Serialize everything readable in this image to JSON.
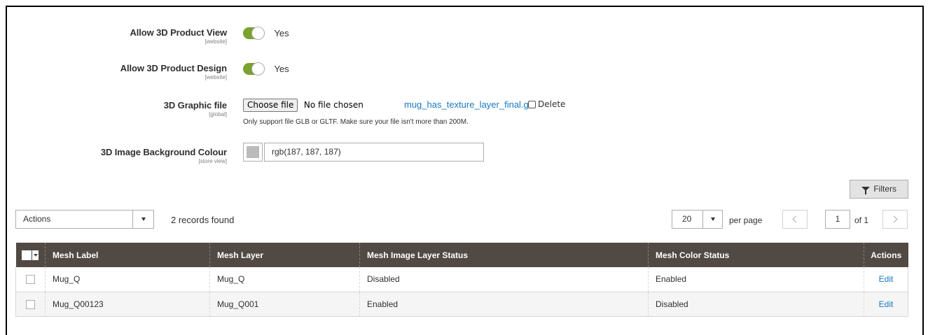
{
  "form": {
    "allow_3d_view": {
      "label": "Allow 3D Product View",
      "scope": "[website]",
      "value": "Yes",
      "enabled": true
    },
    "allow_3d_design": {
      "label": "Allow 3D Product Design",
      "scope": "[website]",
      "value": "Yes",
      "enabled": true
    },
    "graphic_file": {
      "label": "3D Graphic file",
      "scope": "[global]",
      "button_label": "Choose file",
      "status": "No file chosen",
      "current_file": "mug_has_texture_layer_final.glb",
      "delete_label": "Delete",
      "note": "Only support file GLB or GLTF. Make sure your file isn't more than 200M."
    },
    "background_colour": {
      "label": "3D Image Background Colour",
      "scope": "[store view]",
      "value": "rgb(187, 187, 187)",
      "swatch_color": "#bbbbbb"
    }
  },
  "toolbar": {
    "filters_label": "Filters",
    "actions_label": "Actions",
    "records_found": "2 records found",
    "per_page_value": "20",
    "per_page_label": "per page",
    "page_value": "1",
    "page_of": "of 1"
  },
  "grid": {
    "columns": [
      "Mesh Label",
      "Mesh Layer",
      "Mesh Image Layer Status",
      "Mesh Color Status",
      "Actions"
    ],
    "rows": [
      {
        "mesh_label": "Mug_Q",
        "mesh_layer": "Mug_Q",
        "image_layer_status": "Disabled",
        "color_status": "Enabled",
        "action": "Edit"
      },
      {
        "mesh_label": "Mug_Q00123",
        "mesh_layer": "Mug_Q001",
        "image_layer_status": "Enabled",
        "color_status": "Disabled",
        "action": "Edit"
      }
    ]
  },
  "colors": {
    "toggle_on": "#79a22e",
    "header_bg": "#514943",
    "link": "#1979c3"
  }
}
